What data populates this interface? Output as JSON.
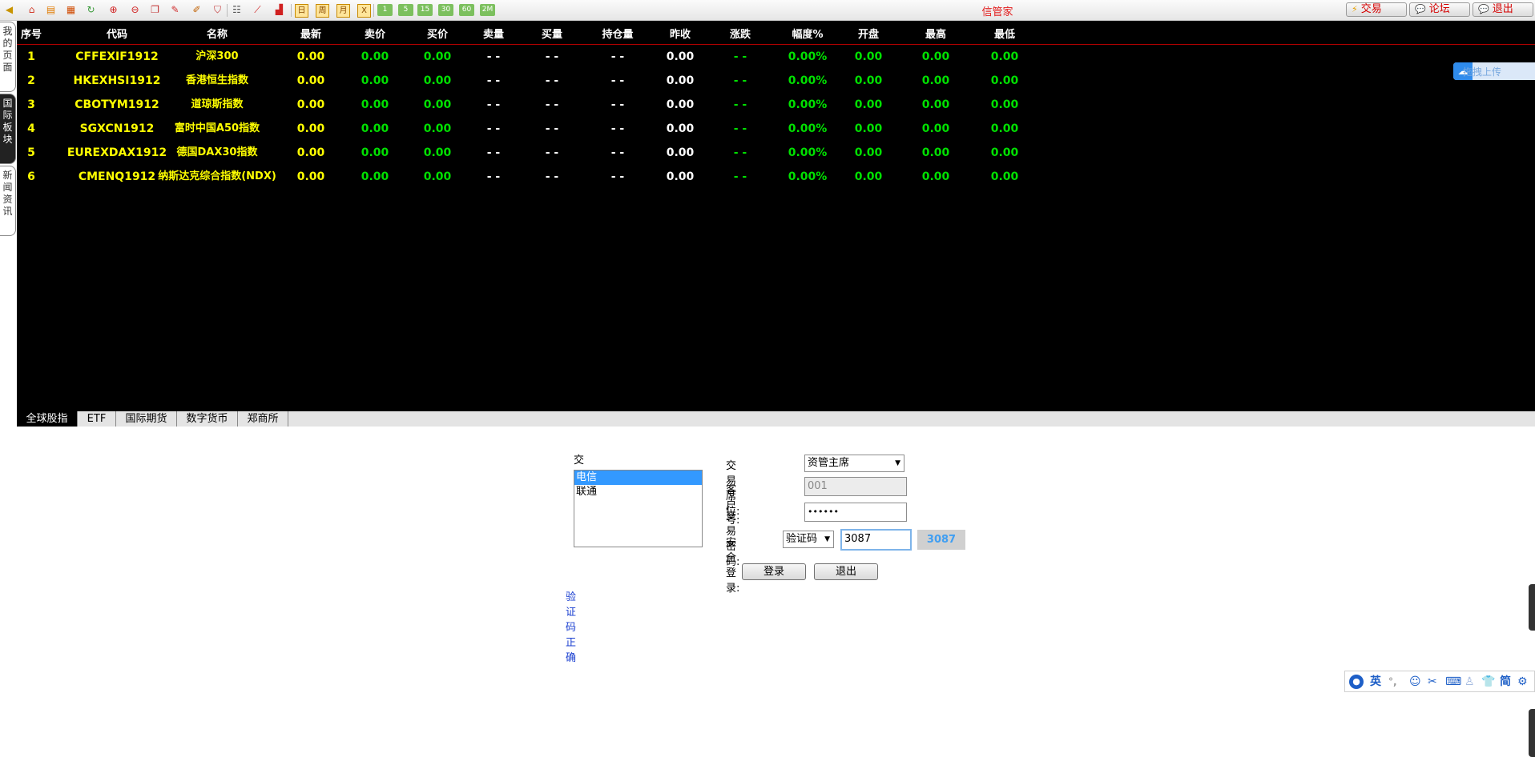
{
  "toolbar": {
    "icons": [
      "back-arrow-icon",
      "home-icon",
      "book-icon",
      "folder-icon",
      "refresh-icon",
      "zoom-in-icon",
      "zoom-out-icon",
      "window-icon",
      "pen-icon",
      "brush-icon",
      "filter-icon",
      "table-icon",
      "line-chart-icon",
      "bar-chart-icon"
    ],
    "calendar_labels": [
      "日",
      "周",
      "月",
      "X"
    ],
    "period_labels": [
      "1",
      "5",
      "15",
      "30",
      "60",
      "2M"
    ],
    "app_title": "信管家",
    "trade_btn": "交易",
    "forum_btn": "论坛",
    "exit_btn": "退出"
  },
  "side_tabs": [
    {
      "label": "我的页面",
      "active": false
    },
    {
      "label": "国际板块",
      "active": true
    },
    {
      "label": "新闻资讯",
      "active": false
    }
  ],
  "quote_table": {
    "headers": [
      "序号",
      "代码",
      "名称",
      "最新",
      "卖价",
      "买价",
      "卖量",
      "买量",
      "持仓量",
      "昨收",
      "涨跌",
      "幅度%",
      "开盘",
      "最高",
      "最低"
    ],
    "rows": [
      [
        "1",
        "CFFEXIF1912",
        "沪深300",
        "0.00",
        "0.00",
        "0.00",
        "- -",
        "- -",
        "- -",
        "0.00",
        "- -",
        "0.00%",
        "0.00",
        "0.00",
        "0.00"
      ],
      [
        "2",
        "HKEXHSI1912",
        "香港恒生指数",
        "0.00",
        "0.00",
        "0.00",
        "- -",
        "- -",
        "- -",
        "0.00",
        "- -",
        "0.00%",
        "0.00",
        "0.00",
        "0.00"
      ],
      [
        "3",
        "CBOTYM1912",
        "道琼斯指数",
        "0.00",
        "0.00",
        "0.00",
        "- -",
        "- -",
        "- -",
        "0.00",
        "- -",
        "0.00%",
        "0.00",
        "0.00",
        "0.00"
      ],
      [
        "4",
        "SGXCN1912",
        "富时中国A50指数",
        "0.00",
        "0.00",
        "0.00",
        "- -",
        "- -",
        "- -",
        "0.00",
        "- -",
        "0.00%",
        "0.00",
        "0.00",
        "0.00"
      ],
      [
        "5",
        "EUREXDAX1912",
        "德国DAX30指数",
        "0.00",
        "0.00",
        "0.00",
        "- -",
        "- -",
        "- -",
        "0.00",
        "- -",
        "0.00%",
        "0.00",
        "0.00",
        "0.00"
      ],
      [
        "6",
        "CMENQ1912",
        "纳斯达克综合指数(NDX)",
        "0.00",
        "0.00",
        "0.00",
        "- -",
        "- -",
        "- -",
        "0.00",
        "- -",
        "0.00%",
        "0.00",
        "0.00",
        "0.00"
      ]
    ]
  },
  "bottom_tabs": [
    {
      "label": "全球股指",
      "active": true
    },
    {
      "label": "ETF",
      "active": false
    },
    {
      "label": "国际期货",
      "active": false
    },
    {
      "label": "数字货币",
      "active": false
    },
    {
      "label": "郑商所",
      "active": false
    }
  ],
  "upload_badge": {
    "label": "拖拽上传"
  },
  "login": {
    "location_label": "交易地点:",
    "locations": [
      {
        "label": "电信",
        "selected": true
      },
      {
        "label": "联通",
        "selected": false
      }
    ],
    "seat_label": "交易席位:",
    "seat_value": "资管主席",
    "client_label": "客 户 号:",
    "client_value": "001",
    "password_label": "交易密码:",
    "password_value": "••••••",
    "secure_label": "安全登录:",
    "secure_method": "验证码",
    "captcha_input": "3087",
    "captcha_image": "3087",
    "login_btn": "登录",
    "exit_btn": "退出",
    "status": "验证码正确"
  },
  "ime": {
    "items": [
      "user-icon",
      "英",
      "°,",
      "smile-icon",
      "scissors-icon",
      "keyboard-icon",
      "person-icon",
      "shirt-icon",
      "简",
      "gear-icon"
    ]
  },
  "colors": {
    "quote_bg": "#000000",
    "header_line": "#b00000",
    "code_yellow": "#ffff00",
    "value_green": "#00e000",
    "title_red": "#e21b1b"
  }
}
